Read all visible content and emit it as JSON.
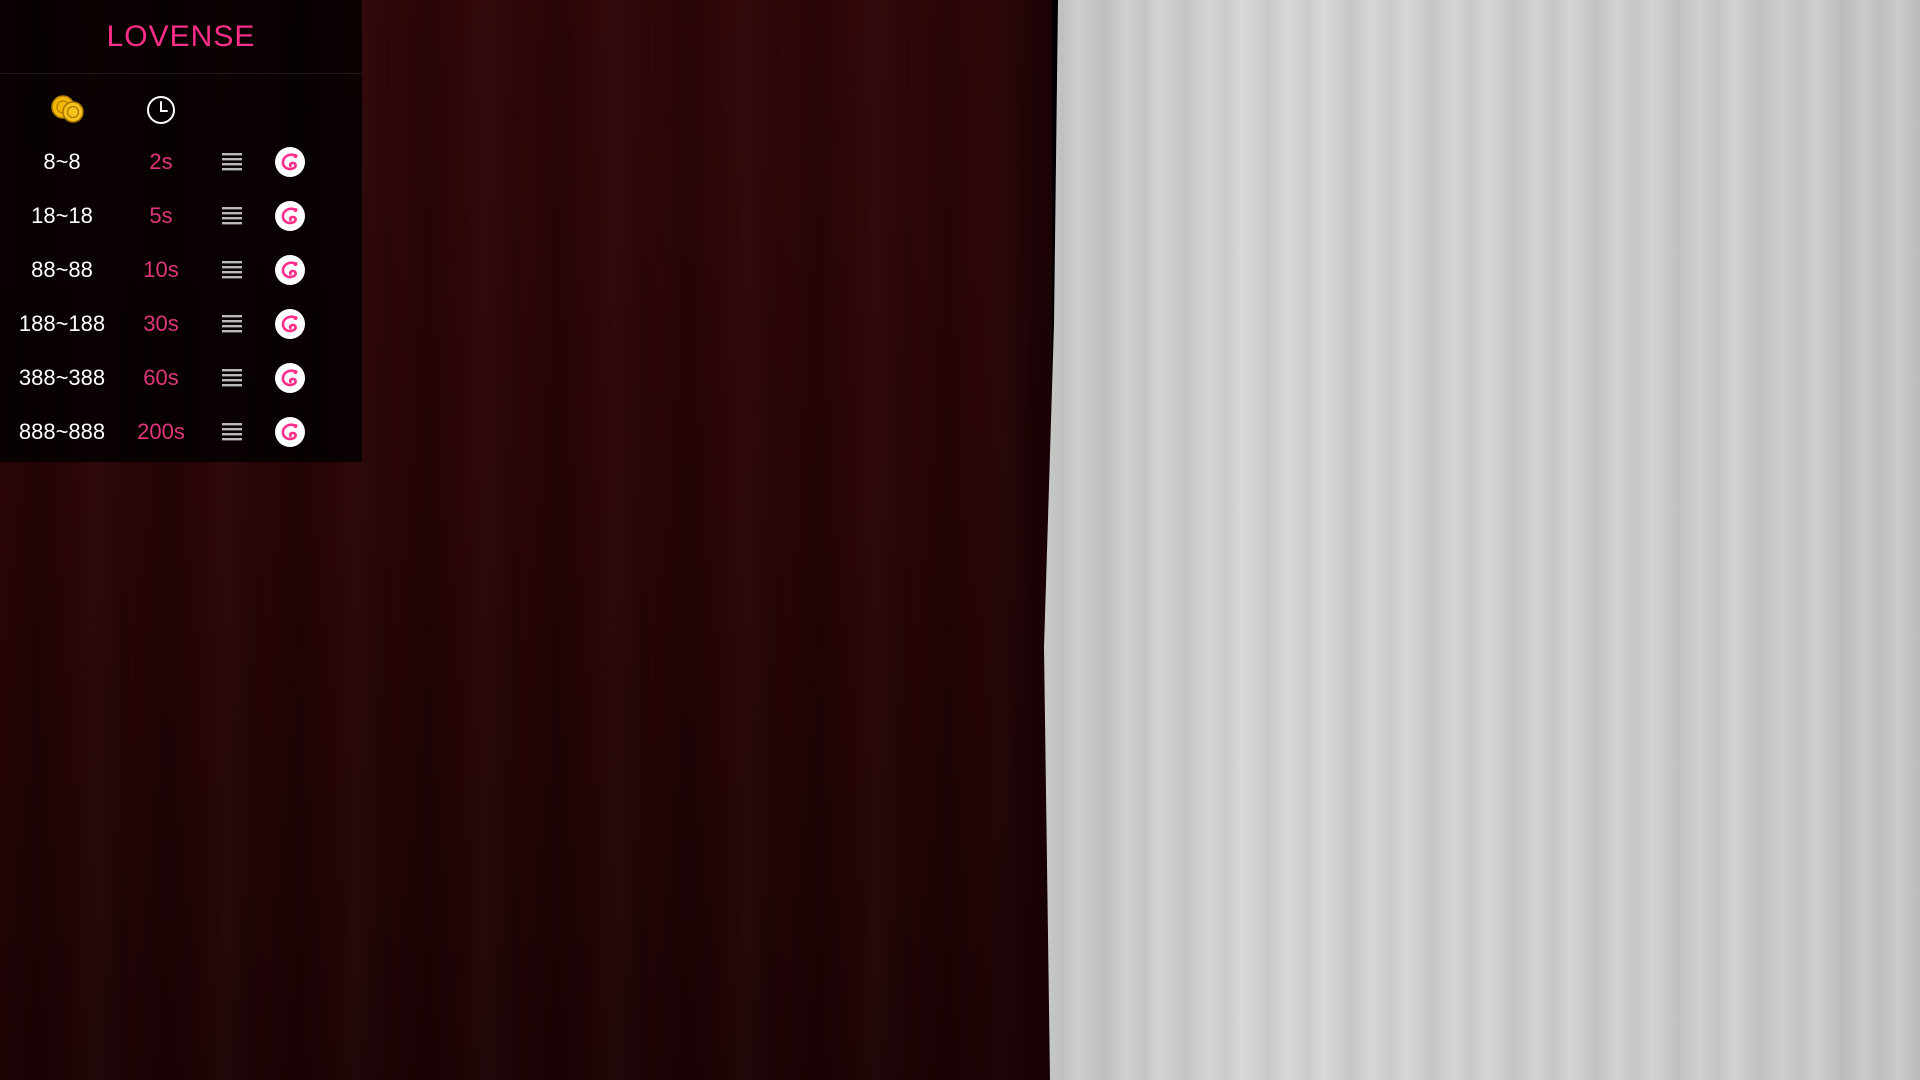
{
  "panel": {
    "brand": "LOVENSE",
    "header_icons": [
      "coins-icon",
      "clock-icon"
    ],
    "levels": [
      {
        "amount": "8~8",
        "duration": "2s",
        "level_icon": "vibration-level-icon",
        "mode_icon": "lovense-toy-icon"
      },
      {
        "amount": "18~18",
        "duration": "5s",
        "level_icon": "vibration-level-icon",
        "mode_icon": "lovense-toy-icon"
      },
      {
        "amount": "88~88",
        "duration": "10s",
        "level_icon": "vibration-level-icon",
        "mode_icon": "lovense-toy-icon"
      },
      {
        "amount": "188~188",
        "duration": "30s",
        "level_icon": "vibration-level-icon",
        "mode_icon": "lovense-toy-icon"
      },
      {
        "amount": "388~388",
        "duration": "60s",
        "level_icon": "vibration-level-icon",
        "mode_icon": "lovense-toy-icon"
      },
      {
        "amount": "888~888",
        "duration": "200s",
        "level_icon": "vibration-level-icon",
        "mode_icon": "lovense-toy-icon"
      }
    ]
  },
  "colors": {
    "brand_pink": "#ff2e8a",
    "duration_pink": "#e0357c",
    "coin_gold": "#f0b400",
    "panel_background": "rgba(0,0,0,0.78)"
  }
}
